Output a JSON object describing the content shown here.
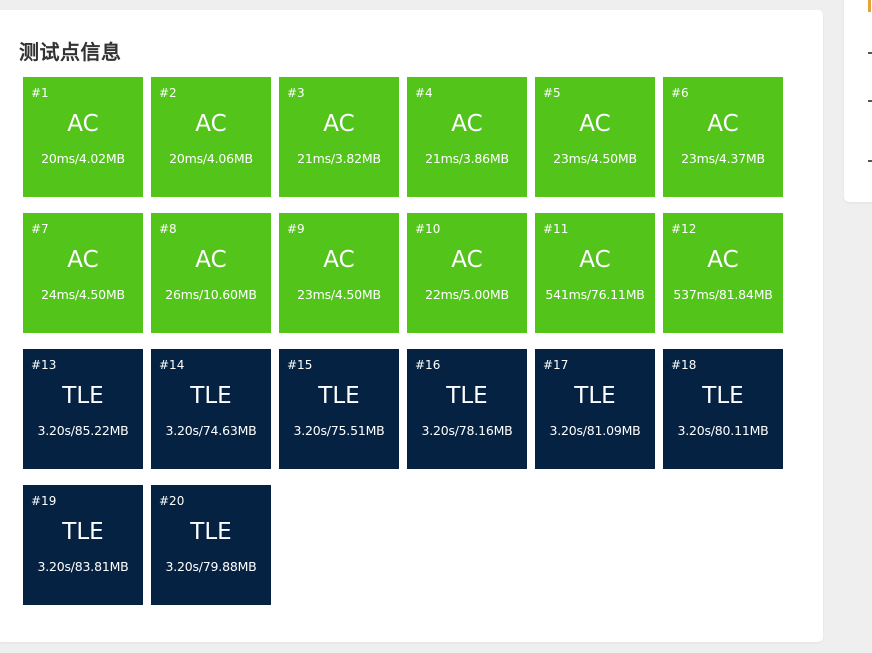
{
  "panel": {
    "title": "测试点信息"
  },
  "testcases": [
    {
      "id": "#1",
      "status": "AC",
      "detail": "20ms/4.02MB"
    },
    {
      "id": "#2",
      "status": "AC",
      "detail": "20ms/4.06MB"
    },
    {
      "id": "#3",
      "status": "AC",
      "detail": "21ms/3.82MB"
    },
    {
      "id": "#4",
      "status": "AC",
      "detail": "21ms/3.86MB"
    },
    {
      "id": "#5",
      "status": "AC",
      "detail": "23ms/4.50MB"
    },
    {
      "id": "#6",
      "status": "AC",
      "detail": "23ms/4.37MB"
    },
    {
      "id": "#7",
      "status": "AC",
      "detail": "24ms/4.50MB"
    },
    {
      "id": "#8",
      "status": "AC",
      "detail": "26ms/10.60MB"
    },
    {
      "id": "#9",
      "status": "AC",
      "detail": "23ms/4.50MB"
    },
    {
      "id": "#10",
      "status": "AC",
      "detail": "22ms/5.00MB"
    },
    {
      "id": "#11",
      "status": "AC",
      "detail": "541ms/76.11MB"
    },
    {
      "id": "#12",
      "status": "AC",
      "detail": "537ms/81.84MB"
    },
    {
      "id": "#13",
      "status": "TLE",
      "detail": "3.20s/85.22MB"
    },
    {
      "id": "#14",
      "status": "TLE",
      "detail": "3.20s/74.63MB"
    },
    {
      "id": "#15",
      "status": "TLE",
      "detail": "3.20s/75.51MB"
    },
    {
      "id": "#16",
      "status": "TLE",
      "detail": "3.20s/78.16MB"
    },
    {
      "id": "#17",
      "status": "TLE",
      "detail": "3.20s/81.09MB"
    },
    {
      "id": "#18",
      "status": "TLE",
      "detail": "3.20s/80.11MB"
    },
    {
      "id": "#19",
      "status": "TLE",
      "detail": "3.20s/83.81MB"
    },
    {
      "id": "#20",
      "status": "TLE",
      "detail": "3.20s/79.88MB"
    }
  ],
  "colors": {
    "ac": "#52c41a",
    "tle": "#052242"
  }
}
